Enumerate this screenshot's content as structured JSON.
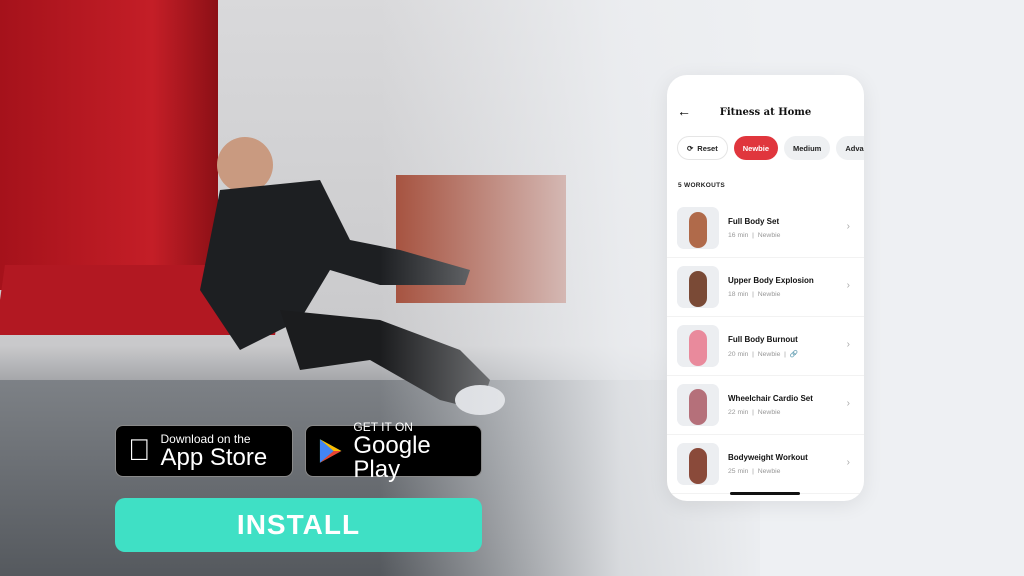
{
  "stores": {
    "apple": {
      "small": "Download on the",
      "big": "App Store"
    },
    "google": {
      "small": "GET IT ON",
      "big": "Google Play"
    }
  },
  "install_label": "INSTALL",
  "app": {
    "title": "Fitness at Home",
    "filters": [
      "Reset",
      "Newbie",
      "Medium",
      "Advance"
    ],
    "active_filter": "Newbie",
    "count_label": "5 WORKOUTS",
    "workouts": [
      {
        "name": "Full Body Set",
        "duration": "16 min",
        "level": "Newbie"
      },
      {
        "name": "Upper Body Explosion",
        "duration": "18 min",
        "level": "Newbie"
      },
      {
        "name": "Full Body Burnout",
        "duration": "20 min",
        "level": "Newbie",
        "icon": "link-icon"
      },
      {
        "name": "Wheelchair Cardio Set",
        "duration": "22 min",
        "level": "Newbie"
      },
      {
        "name": "Bodyweight Workout",
        "duration": "25 min",
        "level": "Newbie"
      }
    ]
  },
  "colors": {
    "accent": "#e0363d",
    "install": "#3fe0c5"
  }
}
